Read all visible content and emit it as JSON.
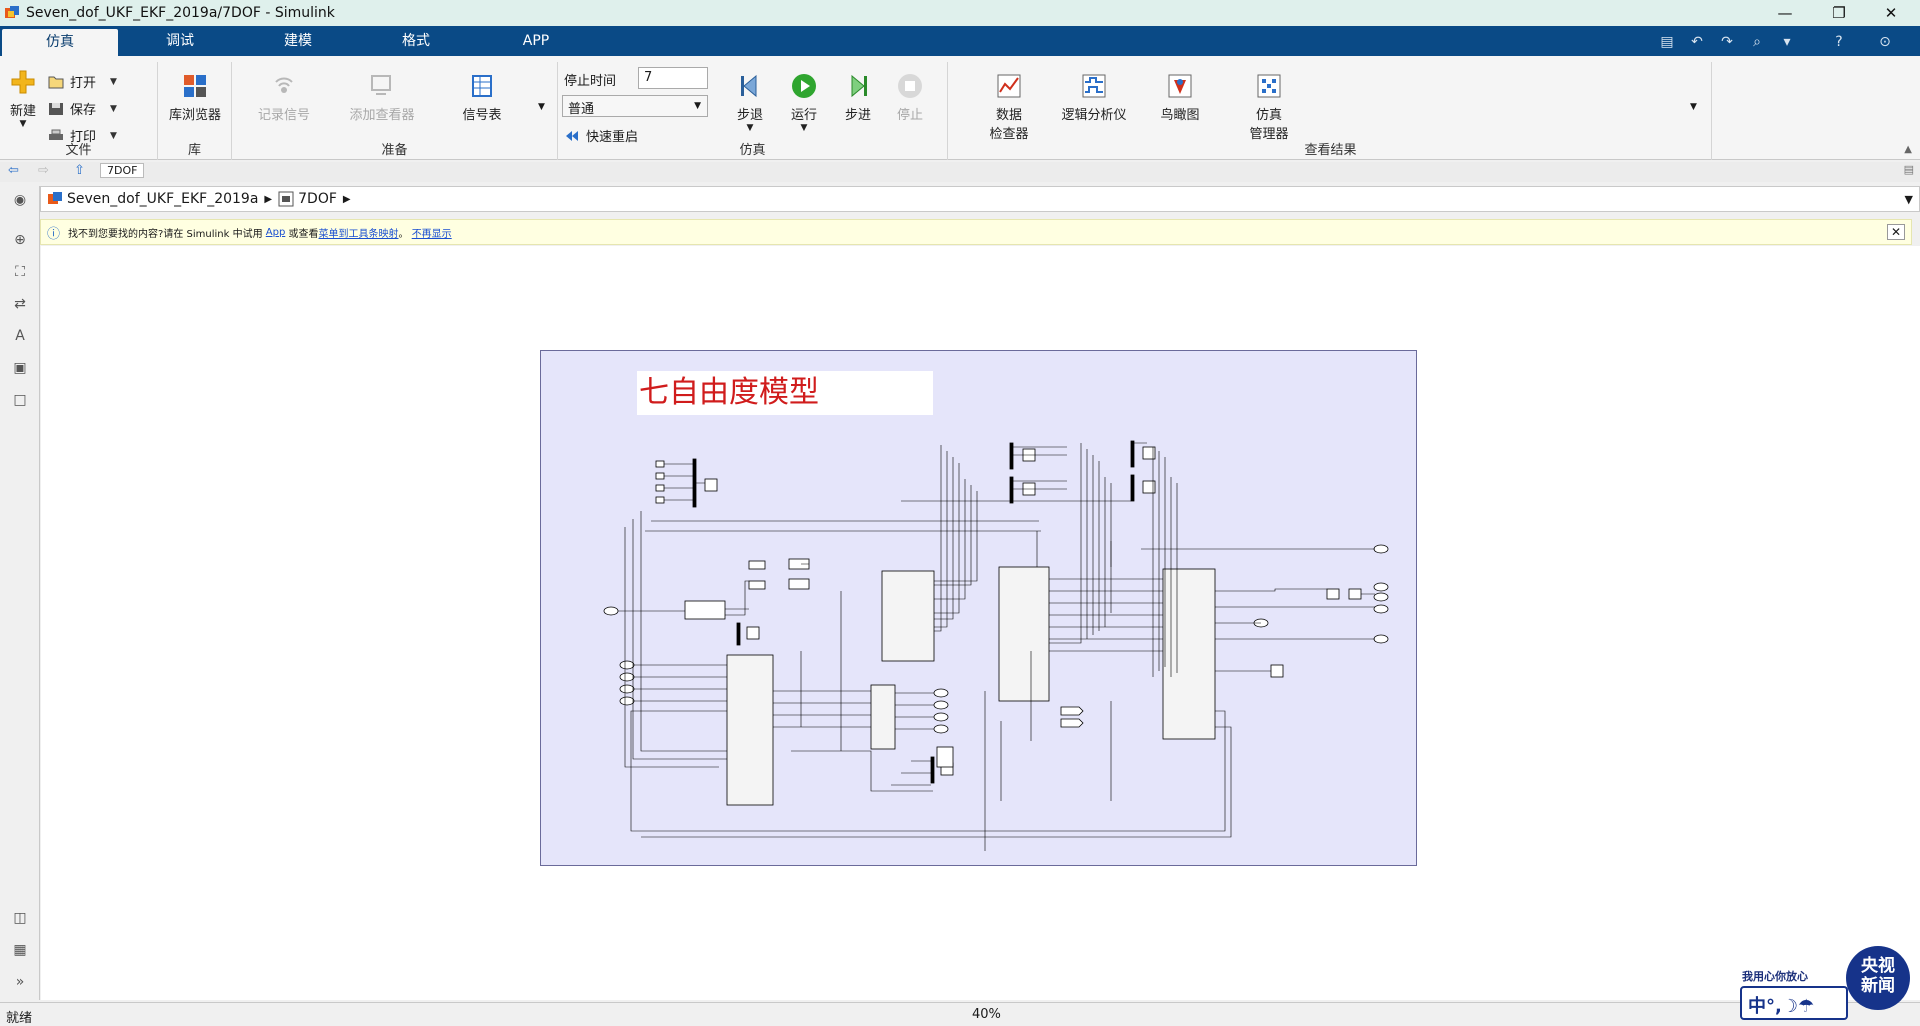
{
  "window": {
    "title": "Seven_dof_UKF_EKF_2019a/7DOF - Simulink",
    "controls": [
      "—",
      "❐",
      "✕"
    ]
  },
  "tabs": [
    {
      "label": "仿真",
      "active": true
    },
    {
      "label": "调试",
      "active": false
    },
    {
      "label": "建模",
      "active": false
    },
    {
      "label": "格式",
      "active": false
    },
    {
      "label": "APP",
      "active": false
    }
  ],
  "ribbon": {
    "file": {
      "label": "文件",
      "new": "新建",
      "open": "打开",
      "save": "保存",
      "print": "打印"
    },
    "library": {
      "label": "库",
      "browser": "库浏览器"
    },
    "prepare": {
      "label": "准备",
      "log_signals": "记录信号",
      "add_viewer": "添加查看器",
      "signal_table": "信号表"
    },
    "simulate": {
      "label": "仿真",
      "stop_time_label": "停止时间",
      "stop_time_value": "7",
      "mode": "普通",
      "fast_restart": "快速重启",
      "step_back": "步退",
      "run": "运行",
      "step_forward": "步进",
      "stop": "停止"
    },
    "review": {
      "label": "查看结果",
      "data_inspector_l1": "数据",
      "data_inspector_l2": "检查器",
      "logic_analyzer": "逻辑分析仪",
      "birds_eye": "鸟瞰图",
      "sim_manager_l1": "仿真",
      "sim_manager_l2": "管理器"
    }
  },
  "nav": {
    "history_tab": "7DOF"
  },
  "breadcrumb": {
    "root": "Seven_dof_UKF_EKF_2019a",
    "child": "7DOF"
  },
  "notice": {
    "text_before": "找不到您要找的内容?请在 Simulink 中试用",
    "link_app": "App",
    "text_mid": "或查看",
    "link_map": "菜单到工具条映射",
    "text_after": "。",
    "link_dismiss": "不再显示"
  },
  "model": {
    "title": "七自由度模型"
  },
  "status": {
    "left": "就绪",
    "zoom": "40%"
  },
  "watermark": {
    "slogan": "我用心你放心",
    "brand_l1": "央视",
    "brand_l2": "新闻",
    "ime": "中°,☽☂"
  },
  "colors": {
    "tabbar": "#0a4a86",
    "model_bg": "#e5e5fa",
    "title_red": "#d01c1c",
    "notice_bg": "#ffffe1",
    "run_green": "#2fa52f"
  }
}
